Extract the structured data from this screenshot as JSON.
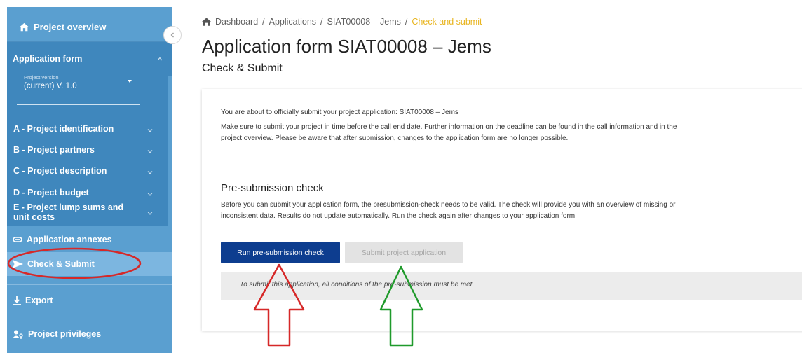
{
  "sidebar": {
    "project_overview": "Project overview",
    "application_form": "Application form",
    "version_label": "Project version",
    "version_value": "(current) V. 1.0",
    "sections": [
      {
        "label": "A - Project identification"
      },
      {
        "label": "B - Project partners"
      },
      {
        "label": "C - Project description"
      },
      {
        "label": "D - Project budget"
      },
      {
        "label": "E - Project lump sums and unit costs"
      }
    ],
    "application_annexes": "Application annexes",
    "check_submit": "Check & Submit",
    "export": "Export",
    "project_privileges": "Project privileges"
  },
  "breadcrumb": {
    "items": [
      "Dashboard",
      "Applications",
      "SIAT00008 – Jems"
    ],
    "current": "Check and submit",
    "separator": "/"
  },
  "header": {
    "title": "Application form SIAT00008 – Jems",
    "subtitle": "Check & Submit"
  },
  "main": {
    "intro": "You are about to officially submit your project application: SIAT00008 – Jems",
    "deadline_note": "Make sure to submit your project in time before the call end date. Further information on the deadline can be found in the call information and in the project overview. Please be aware that after submission, changes to the application form are no longer possible.",
    "presubmission_heading": "Pre-submission check",
    "presubmission_text": "Before you can submit your application form, the presubmission-check needs to be valid. The check will provide you with an overview of missing or inconsistent data. Results do not update automatically. Run the check again after changes to your application form.",
    "run_check_label": "Run pre-submission check",
    "submit_label": "Submit project application",
    "info_text": "To submit this application, all conditions of the pre-submission must be met."
  },
  "colors": {
    "sidebar": "#5a9fd0",
    "sidebar_section": "#3f87bd",
    "sidebar_active": "#7cb6e0",
    "primary_button": "#0d3d8f",
    "breadcrumb_current": "#e8b520",
    "annotation_red": "#d62828",
    "annotation_green": "#1f9a2b"
  }
}
